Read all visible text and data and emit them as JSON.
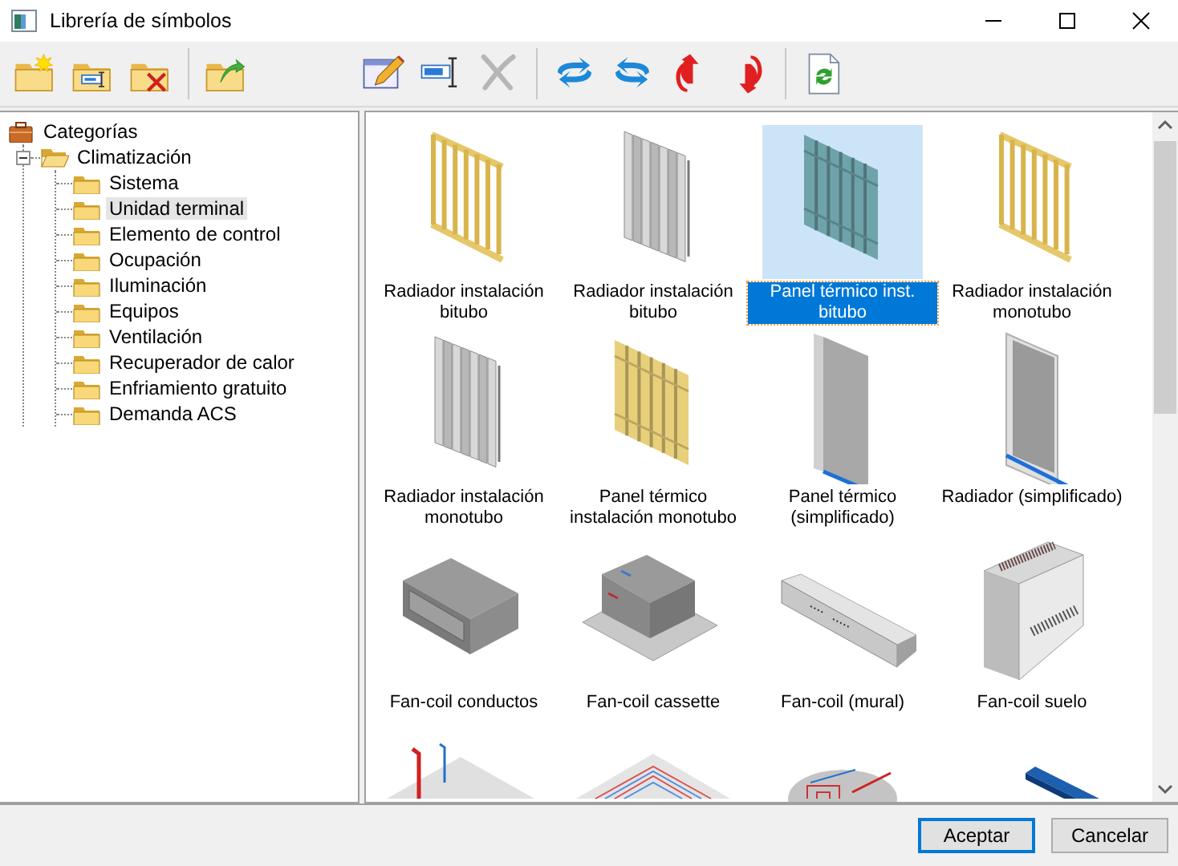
{
  "window": {
    "title": "Librería de símbolos"
  },
  "toolbar": [
    {
      "kind": "new-folder",
      "disabled": false
    },
    {
      "kind": "rename-folder",
      "disabled": false
    },
    {
      "kind": "delete-folder",
      "disabled": false
    },
    {
      "kind": "separator"
    },
    {
      "kind": "export-folder",
      "disabled": false
    },
    {
      "kind": "gap"
    },
    {
      "kind": "edit",
      "disabled": false
    },
    {
      "kind": "rename",
      "disabled": false
    },
    {
      "kind": "delete",
      "disabled": true
    },
    {
      "kind": "separator"
    },
    {
      "kind": "rotate-left",
      "disabled": false
    },
    {
      "kind": "rotate-right",
      "disabled": false
    },
    {
      "kind": "flip-up",
      "disabled": false
    },
    {
      "kind": "flip-down",
      "disabled": false
    },
    {
      "kind": "separator"
    },
    {
      "kind": "refresh",
      "disabled": false
    }
  ],
  "tree": [
    {
      "label": "Categorías",
      "kind": "root",
      "selected": false,
      "children": [
        {
          "label": "Climatización",
          "kind": "folder",
          "selected": false,
          "expanded": true,
          "children": [
            {
              "label": "Sistema",
              "kind": "folder",
              "selected": false
            },
            {
              "label": "Unidad terminal",
              "kind": "folder",
              "selected": true
            },
            {
              "label": "Elemento de control",
              "kind": "folder",
              "selected": false
            },
            {
              "label": "Ocupación",
              "kind": "folder",
              "selected": false
            },
            {
              "label": "Iluminación",
              "kind": "folder",
              "selected": false
            },
            {
              "label": "Equipos",
              "kind": "folder",
              "selected": false
            },
            {
              "label": "Ventilación",
              "kind": "folder",
              "selected": false
            },
            {
              "label": "Recuperador de calor",
              "kind": "folder",
              "selected": false
            },
            {
              "label": "Enfriamiento gratuito",
              "kind": "folder",
              "selected": false
            },
            {
              "label": "Demanda ACS",
              "kind": "folder",
              "selected": false
            }
          ]
        }
      ]
    }
  ],
  "symbols": [
    {
      "label": "Radiador instalación bitubo",
      "kind": "tube-radiator",
      "selected": false
    },
    {
      "label": "Radiador instalación bitubo",
      "kind": "column-radiator",
      "selected": false
    },
    {
      "label": "Panel térmico inst. bitubo",
      "kind": "finned-panel",
      "color": "#6fa3ab",
      "selected": true
    },
    {
      "label": "Radiador instalación monotubo",
      "kind": "tube-radiator",
      "selected": false
    },
    {
      "label": "Radiador instalación monotubo",
      "kind": "column-radiator",
      "selected": false
    },
    {
      "label": "Panel térmico instalación monotubo",
      "kind": "finned-panel",
      "color": "#e8cf7a",
      "selected": false
    },
    {
      "label": "Panel térmico (simplificado)",
      "kind": "flat-panel",
      "selected": false
    },
    {
      "label": "Radiador (simplificado)",
      "kind": "framed-panel",
      "selected": false
    },
    {
      "label": "Fan-coil conductos",
      "kind": "duct-unit",
      "selected": false
    },
    {
      "label": "Fan-coil cassette",
      "kind": "cassette-unit",
      "selected": false
    },
    {
      "label": "Fan-coil (mural)",
      "kind": "wall-unit",
      "selected": false
    },
    {
      "label": "Fan-coil suelo",
      "kind": "floor-unit",
      "selected": false
    },
    {
      "kind": "pipe-floor",
      "selected": false
    },
    {
      "kind": "coil-floor",
      "selected": false
    },
    {
      "kind": "round-coil",
      "selected": false
    },
    {
      "kind": "beam",
      "selected": false
    }
  ],
  "buttons": [
    {
      "label": "Aceptar",
      "default": true
    },
    {
      "label": "Cancelar",
      "default": false
    }
  ]
}
